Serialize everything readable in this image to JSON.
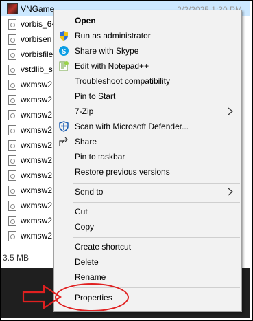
{
  "explorer": {
    "selected_file": "VNGame",
    "date_text": "2/2/2025 1:30 PM",
    "files": [
      "vorbis_64",
      "vorbisen",
      "vorbisfile",
      "vstdlib_s",
      "wxmsw2",
      "wxmsw2",
      "wxmsw2",
      "wxmsw2",
      "wxmsw2",
      "wxmsw2",
      "wxmsw2",
      "wxmsw2",
      "wxmsw2",
      "wxmsw2",
      "wxmsw2"
    ],
    "size_text": "3.5 MB"
  },
  "context_menu": {
    "items": [
      {
        "label": "Open",
        "icon": "none"
      },
      {
        "label": "Run as administrator",
        "icon": "uac-shield-icon"
      },
      {
        "label": "Share with Skype",
        "icon": "skype-icon"
      },
      {
        "label": "Edit with Notepad++",
        "icon": "notepadpp-icon"
      },
      {
        "label": "Troubleshoot compatibility",
        "icon": "none"
      },
      {
        "label": "Pin to Start",
        "icon": "none"
      },
      {
        "label": "7-Zip",
        "icon": "none",
        "submenu": true
      },
      {
        "label": "Scan with Microsoft Defender...",
        "icon": "defender-icon"
      },
      {
        "label": "Share",
        "icon": "share-icon"
      },
      {
        "label": "Pin to taskbar",
        "icon": "none"
      },
      {
        "label": "Restore previous versions",
        "icon": "none"
      },
      {
        "label": "Send to",
        "icon": "none",
        "submenu": true
      },
      {
        "label": "Cut",
        "icon": "none"
      },
      {
        "label": "Copy",
        "icon": "none"
      },
      {
        "label": "Create shortcut",
        "icon": "none"
      },
      {
        "label": "Delete",
        "icon": "none"
      },
      {
        "label": "Rename",
        "icon": "none"
      },
      {
        "label": "Properties",
        "icon": "none"
      }
    ]
  },
  "colors": {
    "highlight": "#e02020",
    "menu_bg": "#f2f2f2",
    "selection": "#cce8ff"
  }
}
